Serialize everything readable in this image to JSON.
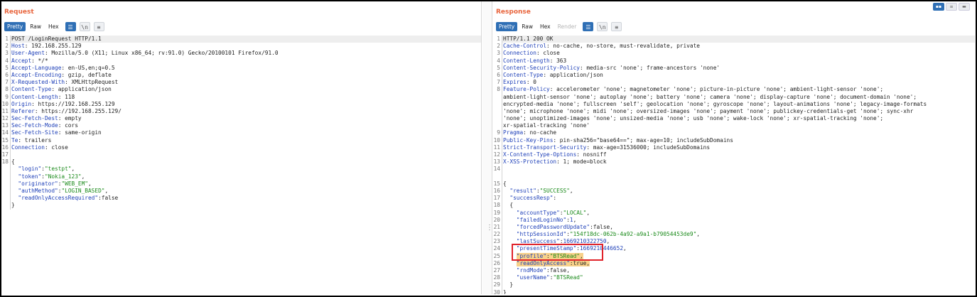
{
  "request": {
    "title": "Request",
    "tabs": [
      "Pretty",
      "Raw",
      "Hex"
    ],
    "lines": [
      [
        {
          "t": "POST /LoginRequest HTTP/1.1"
        }
      ],
      [
        {
          "t": "Host",
          "c": "hk"
        },
        {
          "t": ": 192.168.255.129"
        }
      ],
      [
        {
          "t": "User-Agent",
          "c": "hk"
        },
        {
          "t": ": Mozilla/5.0 (X11; Linux x86_64; rv:91.0) Gecko/20100101 Firefox/91.0"
        }
      ],
      [
        {
          "t": "Accept",
          "c": "hk"
        },
        {
          "t": ": */*"
        }
      ],
      [
        {
          "t": "Accept-Language",
          "c": "hk"
        },
        {
          "t": ": en-US,en;q=0.5"
        }
      ],
      [
        {
          "t": "Accept-Encoding",
          "c": "hk"
        },
        {
          "t": ": gzip, deflate"
        }
      ],
      [
        {
          "t": "X-Requested-With",
          "c": "hk"
        },
        {
          "t": ": XMLHttpRequest"
        }
      ],
      [
        {
          "t": "Content-Type",
          "c": "hk"
        },
        {
          "t": ": application/json"
        }
      ],
      [
        {
          "t": "Content-Length",
          "c": "hk"
        },
        {
          "t": ": 118"
        }
      ],
      [
        {
          "t": "Origin",
          "c": "hk"
        },
        {
          "t": ": https://192.168.255.129"
        }
      ],
      [
        {
          "t": "Referer",
          "c": "hk"
        },
        {
          "t": ": https://192.168.255.129/"
        }
      ],
      [
        {
          "t": "Sec-Fetch-Dest",
          "c": "hk"
        },
        {
          "t": ": empty"
        }
      ],
      [
        {
          "t": "Sec-Fetch-Mode",
          "c": "hk"
        },
        {
          "t": ": cors"
        }
      ],
      [
        {
          "t": "Sec-Fetch-Site",
          "c": "hk"
        },
        {
          "t": ": same-origin"
        }
      ],
      [
        {
          "t": "Te",
          "c": "hk"
        },
        {
          "t": ": trailers"
        }
      ],
      [
        {
          "t": "Connection",
          "c": "hk"
        },
        {
          "t": ": close"
        }
      ],
      [],
      [
        {
          "t": "{"
        }
      ],
      [
        {
          "t": "  "
        },
        {
          "t": "\"login\"",
          "c": "jk"
        },
        {
          "t": ":"
        },
        {
          "t": "\"testpt\"",
          "c": "js"
        },
        {
          "t": ","
        }
      ],
      [
        {
          "t": "  "
        },
        {
          "t": "\"token\"",
          "c": "jk"
        },
        {
          "t": ":"
        },
        {
          "t": "\"Nokia_123\"",
          "c": "js"
        },
        {
          "t": ","
        }
      ],
      [
        {
          "t": "  "
        },
        {
          "t": "\"originator\"",
          "c": "jk"
        },
        {
          "t": ":"
        },
        {
          "t": "\"WEB_EM\"",
          "c": "js"
        },
        {
          "t": ","
        }
      ],
      [
        {
          "t": "  "
        },
        {
          "t": "\"authMethod\"",
          "c": "jk"
        },
        {
          "t": ":"
        },
        {
          "t": "\"LOGIN_BASED\"",
          "c": "js"
        },
        {
          "t": ","
        }
      ],
      [
        {
          "t": "  "
        },
        {
          "t": "\"readOnlyAccessRequired\"",
          "c": "jk"
        },
        {
          "t": ":"
        },
        {
          "t": "false",
          "c": "jb"
        }
      ],
      [
        {
          "t": "}"
        }
      ]
    ],
    "line_numbers": [
      "1",
      "2",
      "3",
      "4",
      "5",
      "6",
      "7",
      "8",
      "9",
      "10",
      "11",
      "12",
      "13",
      "14",
      "15",
      "16",
      "17",
      "18",
      "",
      "",
      "",
      "",
      "",
      ""
    ]
  },
  "response": {
    "title": "Response",
    "tabs": [
      "Pretty",
      "Raw",
      "Hex",
      "Render"
    ],
    "lines": [
      [
        {
          "t": "HTTP/1.1 200 OK"
        }
      ],
      [
        {
          "t": "Cache-Control",
          "c": "hk"
        },
        {
          "t": ": no-cache, no-store, must-revalidate, private"
        }
      ],
      [
        {
          "t": "Connection",
          "c": "hk"
        },
        {
          "t": ": close"
        }
      ],
      [
        {
          "t": "Content-Length",
          "c": "hk"
        },
        {
          "t": ": 363"
        }
      ],
      [
        {
          "t": "Content-Security-Policy",
          "c": "hk"
        },
        {
          "t": ": media-src 'none'; frame-ancestors 'none'"
        }
      ],
      [
        {
          "t": "Content-Type",
          "c": "hk"
        },
        {
          "t": ": application/json"
        }
      ],
      [
        {
          "t": "Expires",
          "c": "hk"
        },
        {
          "t": ": 0"
        }
      ],
      [
        {
          "t": "Feature-Policy",
          "c": "hk"
        },
        {
          "t": ": accelerometer 'none'; magnetometer 'none'; picture-in-picture 'none'; ambient-light-sensor 'none';"
        }
      ],
      [
        {
          "t": "ambient-light-sensor 'none'; autoplay 'none'; battery 'none'; camera 'none'; display-capture 'none'; document-domain 'none';"
        }
      ],
      [
        {
          "t": "encrypted-media 'none'; fullscreen 'self'; geolocation 'none'; gyroscope 'none'; layout-animations 'none'; legacy-image-formats"
        }
      ],
      [
        {
          "t": "'none'; microphone 'none'; midi 'none'; oversized-images 'none'; payment 'none'; publickey-credentials-get 'none'; sync-xhr"
        }
      ],
      [
        {
          "t": "'none'; unoptimized-images 'none'; unsized-media 'none'; usb 'none'; wake-lock 'none'; xr-spatial-tracking 'none';"
        }
      ],
      [
        {
          "t": "xr-spatial-tracking 'none'"
        }
      ],
      [
        {
          "t": "Pragma",
          "c": "hk"
        },
        {
          "t": ": no-cache"
        }
      ],
      [
        {
          "t": "Public-Key-Pins",
          "c": "hk"
        },
        {
          "t": ": pin-sha256=\"base64==\"; max-age=10; includeSubDomains"
        }
      ],
      [
        {
          "t": "Strict-Transport-Security",
          "c": "hk"
        },
        {
          "t": ": max-age=31536000; includeSubDomains"
        }
      ],
      [
        {
          "t": "X-Content-Type-Options",
          "c": "hk"
        },
        {
          "t": ": nosniff"
        }
      ],
      [
        {
          "t": "X-XSS-Protection",
          "c": "hk"
        },
        {
          "t": ": 1; mode=block"
        }
      ],
      [],
      [],
      [
        {
          "t": "{"
        }
      ],
      [
        {
          "t": "  "
        },
        {
          "t": "\"result\"",
          "c": "jk"
        },
        {
          "t": ":"
        },
        {
          "t": "\"SUCCESS\"",
          "c": "js"
        },
        {
          "t": ","
        }
      ],
      [
        {
          "t": "  "
        },
        {
          "t": "\"successResp\"",
          "c": "jk"
        },
        {
          "t": ":"
        }
      ],
      [
        {
          "t": "  {"
        }
      ],
      [
        {
          "t": "    "
        },
        {
          "t": "\"accountType\"",
          "c": "jk"
        },
        {
          "t": ":"
        },
        {
          "t": "\"LOCAL\"",
          "c": "js"
        },
        {
          "t": ","
        }
      ],
      [
        {
          "t": "    "
        },
        {
          "t": "\"failedLoginNo\"",
          "c": "jk"
        },
        {
          "t": ":"
        },
        {
          "t": "1",
          "c": "jn"
        },
        {
          "t": ","
        }
      ],
      [
        {
          "t": "    "
        },
        {
          "t": "\"forcedPasswordUpdate\"",
          "c": "jk"
        },
        {
          "t": ":"
        },
        {
          "t": "false",
          "c": "jb"
        },
        {
          "t": ","
        }
      ],
      [
        {
          "t": "    "
        },
        {
          "t": "\"httpSessionId\"",
          "c": "jk"
        },
        {
          "t": ":"
        },
        {
          "t": "\"154f18dc-062b-4a92-a9a1-b79054453de9\"",
          "c": "js"
        },
        {
          "t": ","
        }
      ],
      [
        {
          "t": "    "
        },
        {
          "t": "\"lastSuccess\"",
          "c": "jk"
        },
        {
          "t": ":"
        },
        {
          "t": "1669210322750",
          "c": "jn"
        },
        {
          "t": ","
        }
      ],
      [
        {
          "t": "    "
        },
        {
          "t": "\"presentTimeStamp\"",
          "c": "jk"
        },
        {
          "t": ":"
        },
        {
          "t": "1669210446652",
          "c": "jn"
        },
        {
          "t": ","
        }
      ],
      [
        {
          "t": "    "
        },
        {
          "t": "\"profile\"",
          "c": "jk hl"
        },
        {
          "t": ":",
          "c": "hl"
        },
        {
          "t": "\"BTSRead\"",
          "c": "js hl"
        },
        {
          "t": ",",
          "c": "hl"
        }
      ],
      [
        {
          "t": "    "
        },
        {
          "t": "\"readOnlyAccess\"",
          "c": "jk hl"
        },
        {
          "t": ":",
          "c": "hl"
        },
        {
          "t": "true",
          "c": "jb hl"
        },
        {
          "t": ",",
          "c": "hl"
        }
      ],
      [
        {
          "t": "    "
        },
        {
          "t": "\"rndMode\"",
          "c": "jk"
        },
        {
          "t": ":"
        },
        {
          "t": "false",
          "c": "jb"
        },
        {
          "t": ","
        }
      ],
      [
        {
          "t": "    "
        },
        {
          "t": "\"userName\"",
          "c": "jk"
        },
        {
          "t": ":"
        },
        {
          "t": "\"BTSRead\"",
          "c": "js"
        }
      ],
      [
        {
          "t": "  }"
        }
      ],
      [
        {
          "t": "}"
        }
      ]
    ],
    "line_numbers": [
      "1",
      "2",
      "3",
      "4",
      "5",
      "6",
      "7",
      "8",
      "",
      "",
      "",
      "",
      "",
      "9",
      "10",
      "11",
      "12",
      "13",
      "14",
      "",
      "15",
      "16",
      "17",
      "18",
      "19",
      "20",
      "21",
      "22",
      "23",
      "24",
      "25",
      "26",
      "27",
      "28",
      "29",
      "30"
    ]
  },
  "toolbar_icons": {
    "wrap": "☰",
    "newline": "\\n",
    "menu": "≡"
  },
  "layout_buttons": [
    "▪▪",
    "≡",
    "▬"
  ]
}
